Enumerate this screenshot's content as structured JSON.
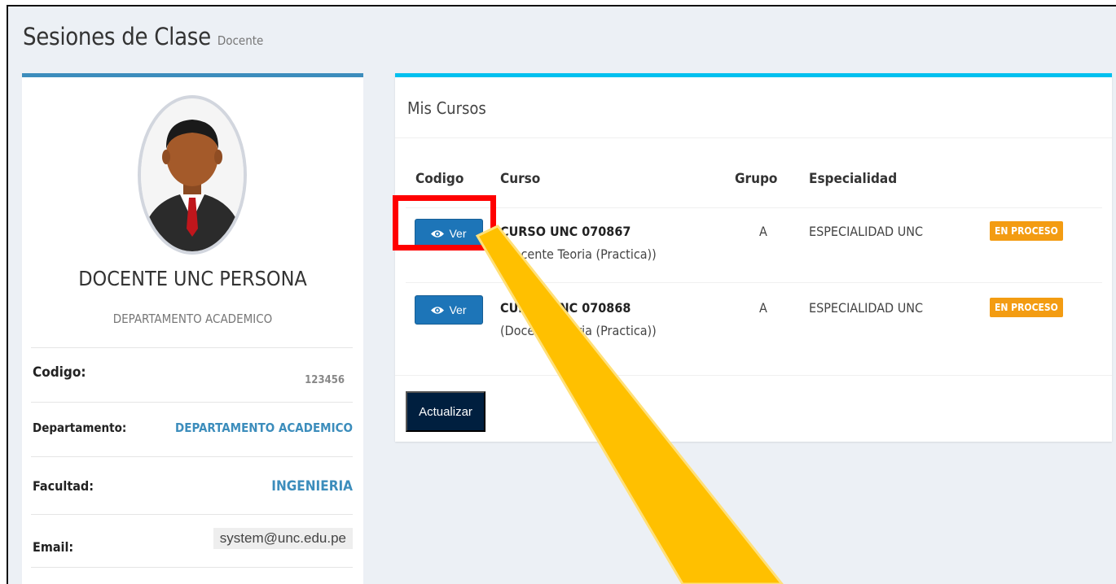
{
  "header": {
    "title": "Sesiones de Clase",
    "subtitle": "Docente"
  },
  "profile": {
    "name": "DOCENTE UNC PERSONA",
    "department": "DEPARTAMENTO ACADEMICO",
    "fields": {
      "code_label": "Codigo:",
      "code_value": "123456",
      "department_label": "Departamento:",
      "department_value": "DEPARTAMENTO ACADEMICO",
      "faculty_label": "Facultad:",
      "faculty_value": "INGENIERIA",
      "email_label": "Email:",
      "email_value": "system@unc.edu.pe"
    }
  },
  "courses": {
    "title": "Mis Cursos",
    "columns": [
      "Codigo",
      "Curso",
      "Grupo",
      "Especialidad"
    ],
    "rows": [
      {
        "button_label": "Ver",
        "course_name": "CURSO UNC 070867",
        "course_role": "(Docente Teoria (Practica))",
        "group": "A",
        "specialty": "ESPECIALIDAD UNC",
        "status": "EN PROCESO"
      },
      {
        "button_label": "Ver",
        "course_name": "CURSO UNC 070868",
        "course_role": "(Docente Teoria (Practica))",
        "group": "A",
        "specialty": "ESPECIALIDAD UNC",
        "status": "EN PROCESO"
      }
    ],
    "update_label": "Actualizar"
  },
  "colors": {
    "primary": "#3c8dbc",
    "info": "#00c0ef",
    "button": "#1d75b8",
    "warning": "#f39c12",
    "navy": "#001f3f",
    "highlight": "#ff0000",
    "arrow": "#ffc000"
  },
  "icons": {
    "view": "eye-icon",
    "avatar": "businessman-avatar"
  }
}
